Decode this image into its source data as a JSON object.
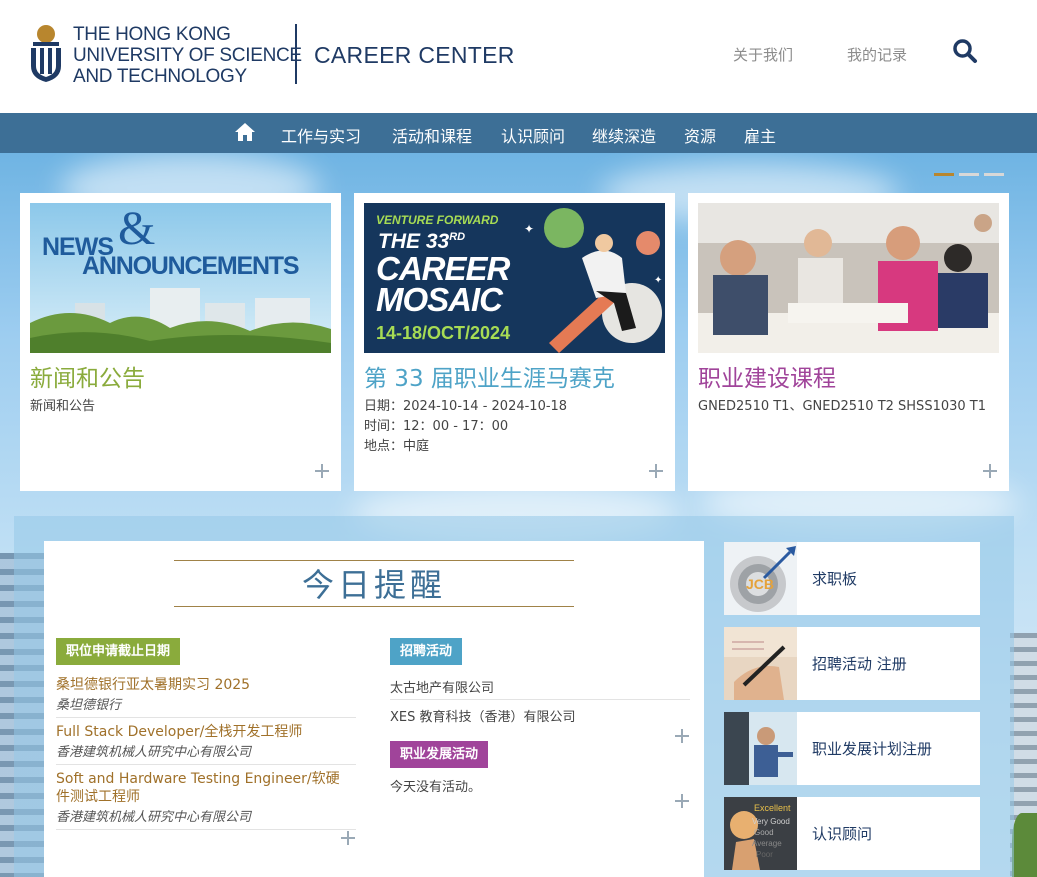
{
  "header": {
    "university_line1": "THE HONG KONG",
    "university_line2": "UNIVERSITY OF SCIENCE",
    "university_line3": "AND TECHNOLOGY",
    "center_name": "CAREER CENTER",
    "links": {
      "about": "关于我们",
      "my_records": "我的记录"
    }
  },
  "nav": {
    "items": [
      "工作与实习",
      "活动和课程",
      "认识顾问",
      "继续深造",
      "资源",
      "雇主"
    ]
  },
  "cards": [
    {
      "image_text_top": "NEWS",
      "image_text_amp": "&",
      "image_text_bottom": "ANNOUNCEMENTS",
      "title": "新闻和公告",
      "text1": "新闻和公告",
      "color": "#8aab3c"
    },
    {
      "image_line1": "VENTURE FORWARD",
      "image_line2": "THE 33",
      "image_line2_sup": "RD",
      "image_line3": "CAREER",
      "image_line4": "MOSAIC",
      "image_line5": "14-18/OCT/2024",
      "title": "第 33 届职业生涯马赛克",
      "date_label": "日期：",
      "date_value": "2024-10-14 - 2024-10-18",
      "time_label": "时间：",
      "time_value": "12：00 - 17：00",
      "place_label": "地点：",
      "place_value": "中庭",
      "color": "#4ea3c7"
    },
    {
      "title": "职业建设课程",
      "text1": "GNED2510 T1、GNED2510 T2 SHSS1030 T1",
      "color": "#a0449a"
    }
  ],
  "today": {
    "title": "今日提醒",
    "deadline_tag": "职位申请截止日期",
    "jobs": [
      {
        "title": "桑坦德银行亚太暑期实习 2025",
        "company": "桑坦德银行"
      },
      {
        "title": "Full Stack Developer/全栈开发工程师",
        "company": "香港建筑机械人研究中心有限公司"
      },
      {
        "title_line1": "Soft and Hardware Testing Engineer/软硬",
        "title_line2": "件测试工程师",
        "company": "香港建筑机械人研究中心有限公司"
      }
    ],
    "recruit_tag": "招聘活动",
    "recruit_items": [
      "太古地产有限公司",
      "XES 教育科技（香港）有限公司"
    ],
    "career_tag": "职业发展活动",
    "career_empty": "今天没有活动。"
  },
  "quick_links": [
    "求职板",
    "招聘活动 注册",
    "职业发展计划注册",
    "认识顾问"
  ],
  "quick_img_text": {
    "excellent": "Excellent",
    "very_good": "Very Good",
    "good": "Good",
    "average": "Average",
    "poor": "Poor"
  },
  "colors": {
    "navy": "#1f3a64",
    "nav_bg": "#3d6f96",
    "gold": "#a0712a",
    "green_tag": "#8aab3c",
    "blue_tag": "#4ea3c7",
    "purple_tag": "#a0449a"
  }
}
